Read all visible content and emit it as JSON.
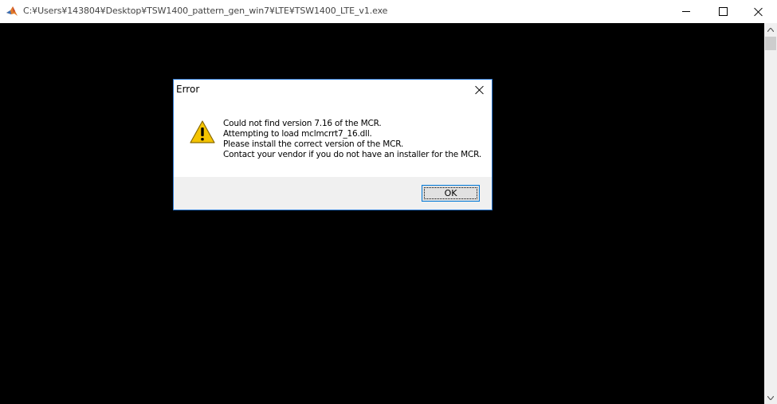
{
  "window": {
    "title": "C:¥Users¥143804¥Desktop¥TSW1400_pattern_gen_win7¥LTE¥TSW1400_LTE_v1.exe",
    "icon": "matlab-icon"
  },
  "dialog": {
    "title": "Error",
    "icon": "warning-icon",
    "messages": [
      "Could not find version 7.16 of the MCR.",
      "Attempting to load mclmcrrt7_16.dll.",
      "Please install the correct version of the MCR.",
      "Contact your vendor if you do not have an installer for the MCR."
    ],
    "ok_label": "OK"
  },
  "colors": {
    "console_background": "#000000",
    "dialog_border": "#2b79d3",
    "warning_fill": "#f5c400"
  }
}
